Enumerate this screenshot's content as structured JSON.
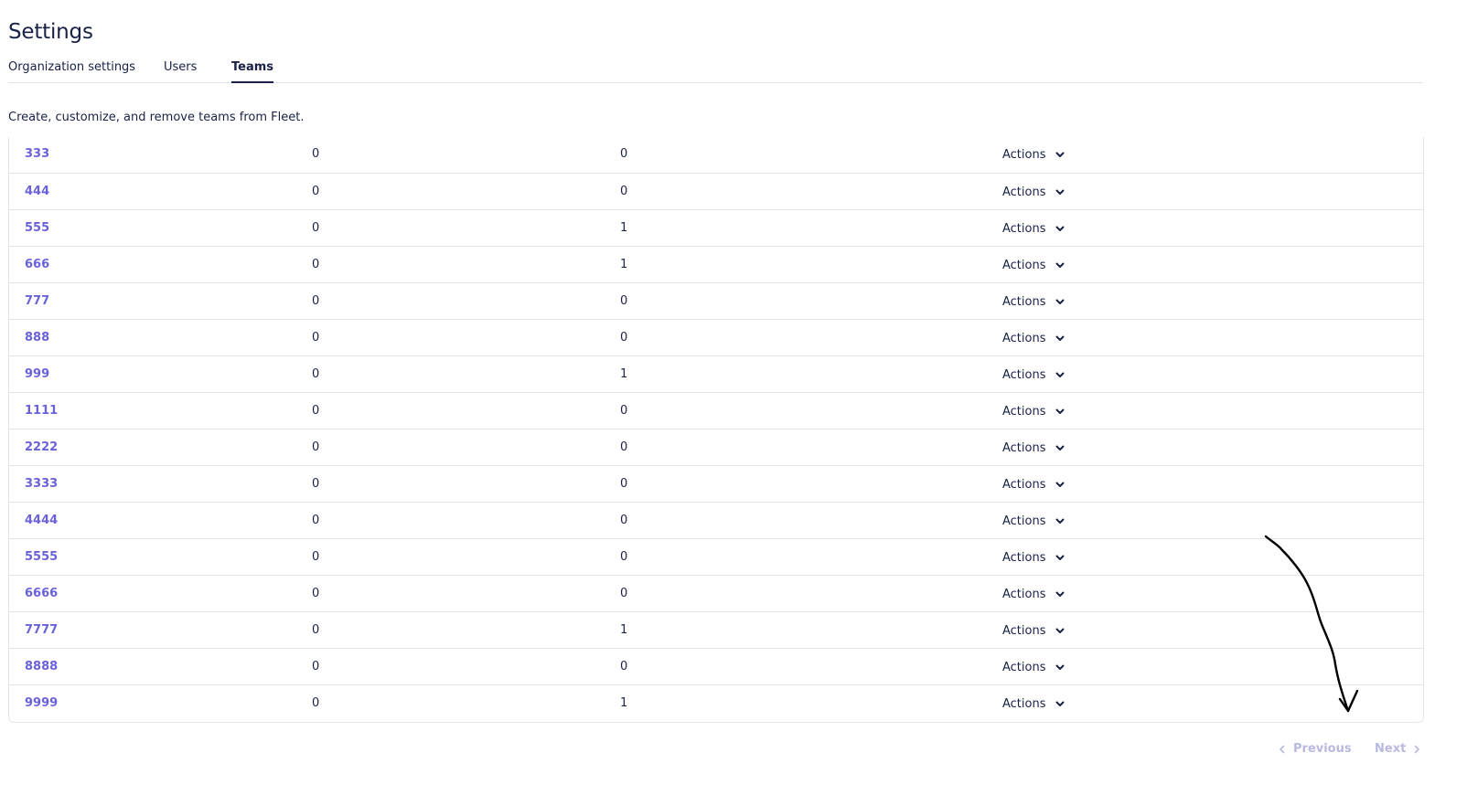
{
  "header": {
    "title": "Settings"
  },
  "tabs": [
    {
      "label": "Organization settings",
      "active": false
    },
    {
      "label": "Users",
      "active": false
    },
    {
      "label": "Teams",
      "active": true
    }
  ],
  "description": "Create, customize, and remove teams from Fleet.",
  "teams_table": {
    "actions_label": "Actions",
    "rows": [
      {
        "name": "333",
        "hosts": "0",
        "members": "0"
      },
      {
        "name": "444",
        "hosts": "0",
        "members": "0"
      },
      {
        "name": "555",
        "hosts": "0",
        "members": "1"
      },
      {
        "name": "666",
        "hosts": "0",
        "members": "1"
      },
      {
        "name": "777",
        "hosts": "0",
        "members": "0"
      },
      {
        "name": "888",
        "hosts": "0",
        "members": "0"
      },
      {
        "name": "999",
        "hosts": "0",
        "members": "1"
      },
      {
        "name": "1111",
        "hosts": "0",
        "members": "0"
      },
      {
        "name": "2222",
        "hosts": "0",
        "members": "0"
      },
      {
        "name": "3333",
        "hosts": "0",
        "members": "0"
      },
      {
        "name": "4444",
        "hosts": "0",
        "members": "0"
      },
      {
        "name": "5555",
        "hosts": "0",
        "members": "0"
      },
      {
        "name": "6666",
        "hosts": "0",
        "members": "0"
      },
      {
        "name": "7777",
        "hosts": "0",
        "members": "1"
      },
      {
        "name": "8888",
        "hosts": "0",
        "members": "0"
      },
      {
        "name": "9999",
        "hosts": "0",
        "members": "1"
      }
    ]
  },
  "pagination": {
    "previous_label": "Previous",
    "next_label": "Next",
    "previous_enabled": false,
    "next_enabled": false
  },
  "colors": {
    "text": "#192147",
    "link": "#6a62d8",
    "border": "#e2e4ea",
    "disabled": "#b8b9e0",
    "annotation": "#000000"
  },
  "icons": {
    "actions_chevron": "chevron-down-icon",
    "previous": "chevron-left-icon",
    "next": "chevron-right-icon",
    "annotation": "hand-drawn-arrow"
  }
}
